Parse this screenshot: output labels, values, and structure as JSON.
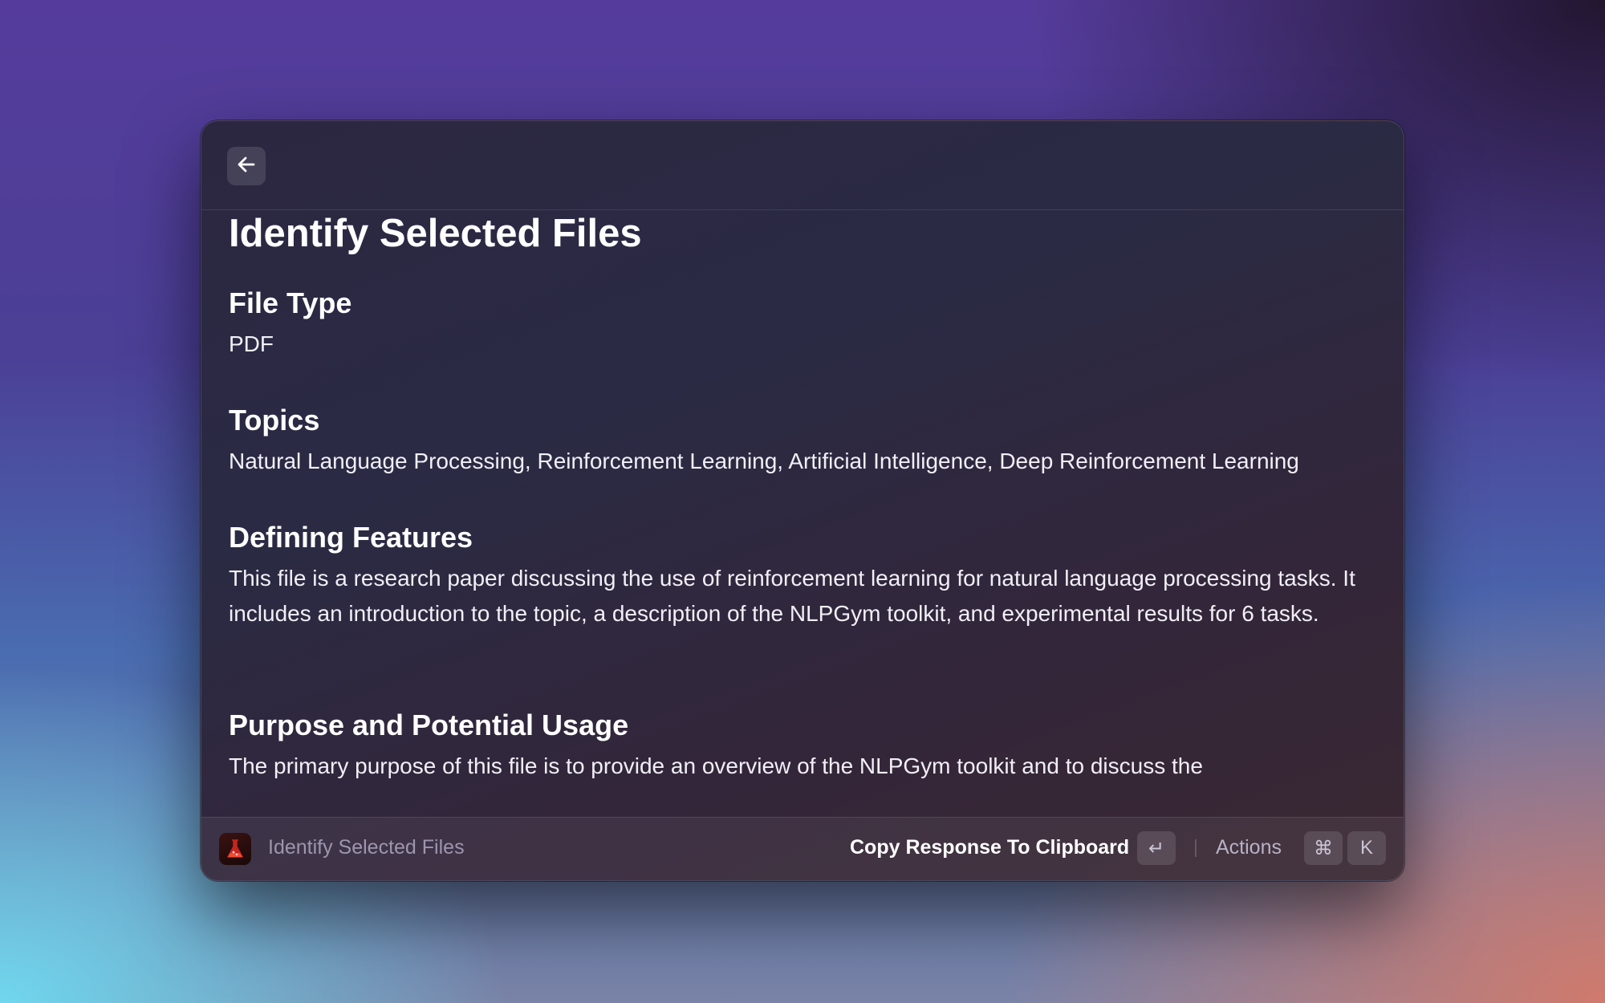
{
  "header": {
    "back_icon": "arrow-left-icon"
  },
  "content": {
    "title": "Identify Selected Files",
    "sections": [
      {
        "heading": "File Type",
        "body": "PDF"
      },
      {
        "heading": "Topics",
        "body": "Natural Language Processing, Reinforcement Learning, Artificial Intelligence, Deep Reinforcement Learning"
      },
      {
        "heading": "Defining Features",
        "body": "This file is a research paper discussing the use of reinforcement learning for natural language processing tasks. It includes an introduction to the topic, a description of the NLPGym toolkit, and experimental results for 6 tasks."
      },
      {
        "heading": "Purpose and Potential Usage",
        "body": "The primary purpose of this file is to provide an overview of the NLPGym toolkit and to discuss the"
      }
    ]
  },
  "footer": {
    "app_icon": "flask-icon",
    "title": "Identify Selected Files",
    "primary_action": "Copy Response To Clipboard",
    "primary_shortcut": "↵",
    "actions_label": "Actions",
    "actions_shortcut_modifier": "⌘",
    "actions_shortcut_key": "K"
  },
  "colors": {
    "window_bg": "#2c2741",
    "text_primary": "#ffffff",
    "text_secondary": "#9c97ad",
    "app_icon_accent": "#e23b2e"
  }
}
